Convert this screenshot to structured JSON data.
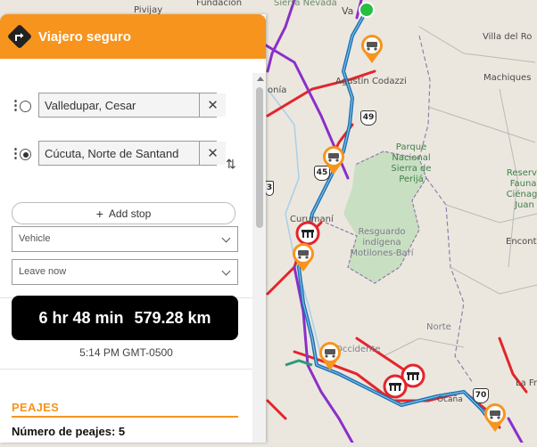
{
  "app": {
    "title": "Viajero seguro",
    "accent_color": "#f7941d",
    "logo_icon": "turn-right-arrow-icon"
  },
  "route_form": {
    "origin": {
      "value": "Valledupar, Cesar"
    },
    "destination": {
      "value": "Cúcuta, Norte de Santand"
    },
    "add_stop_label": "Add stop",
    "vehicle_select": {
      "value": "Vehicle"
    },
    "departure_select": {
      "value": "Leave now"
    }
  },
  "summary": {
    "duration": "6 hr 48 min",
    "distance": "579.28 km",
    "arrival": "5:14 PM GMT-0500"
  },
  "peajes": {
    "title": "PEAJES",
    "count_text": "Número de peajes: 5"
  },
  "map": {
    "labels": {
      "pivijay": "Pivijay",
      "fundacion": "Fundación",
      "sierra_nevada": "Sierra Nevada",
      "valledupar": "Va",
      "villa_rosario": "Villa del Ro",
      "agustin_codazzi": "Agustín Codazzi",
      "machiques": "Machiques",
      "parque": "Parque Nacional Sierra de Perijá",
      "reserva": "Reserva Faunal Ciénaga Juan",
      "curumani": "Curumaní",
      "resguardo": "Resguardo indígena Motilones-Barí",
      "encontrados": "Encont",
      "norte": "Norte",
      "occidente": "Occidente",
      "la_fria": "La Fr",
      "mon": "onía",
      "ocana": "Ocaña"
    },
    "route_shields": [
      "49",
      "45",
      "3",
      "70"
    ],
    "colors": {
      "route_blue": "#1f6fb2",
      "road_red": "#e3252b",
      "road_purple": "#8b2fc9",
      "pin_orange": "#f7941d",
      "pin_red": "#e3252b"
    }
  }
}
